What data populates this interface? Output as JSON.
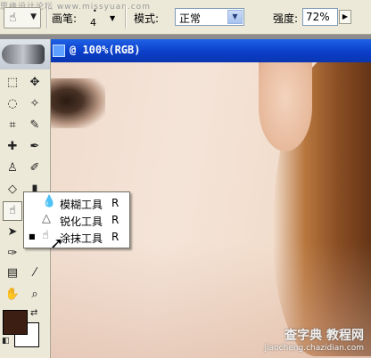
{
  "optbar": {
    "watermark": "思缘设计论坛 www.missyuan.com",
    "brush_label": "画笔:",
    "brush_size": "4",
    "mode_label": "模式:",
    "mode_value": "正常",
    "strength_label": "强度:",
    "strength_value": "72%"
  },
  "document": {
    "title": "@ 100%(RGB)"
  },
  "flyout": {
    "items": [
      {
        "label": "模糊工具",
        "shortcut": "R",
        "icon": "blur-drop-icon",
        "selected": false
      },
      {
        "label": "锐化工具",
        "shortcut": "R",
        "icon": "sharpen-triangle-icon",
        "selected": false
      },
      {
        "label": "涂抹工具",
        "shortcut": "R",
        "icon": "smudge-finger-icon",
        "selected": true
      }
    ]
  },
  "colors": {
    "foreground": "#3c1e12",
    "background": "#ffffff",
    "title_bar": "#0b3fc9"
  },
  "watermark_bottom": {
    "line1": "查字典 教程网",
    "line2": "jiaocheng.chazidian.com"
  }
}
